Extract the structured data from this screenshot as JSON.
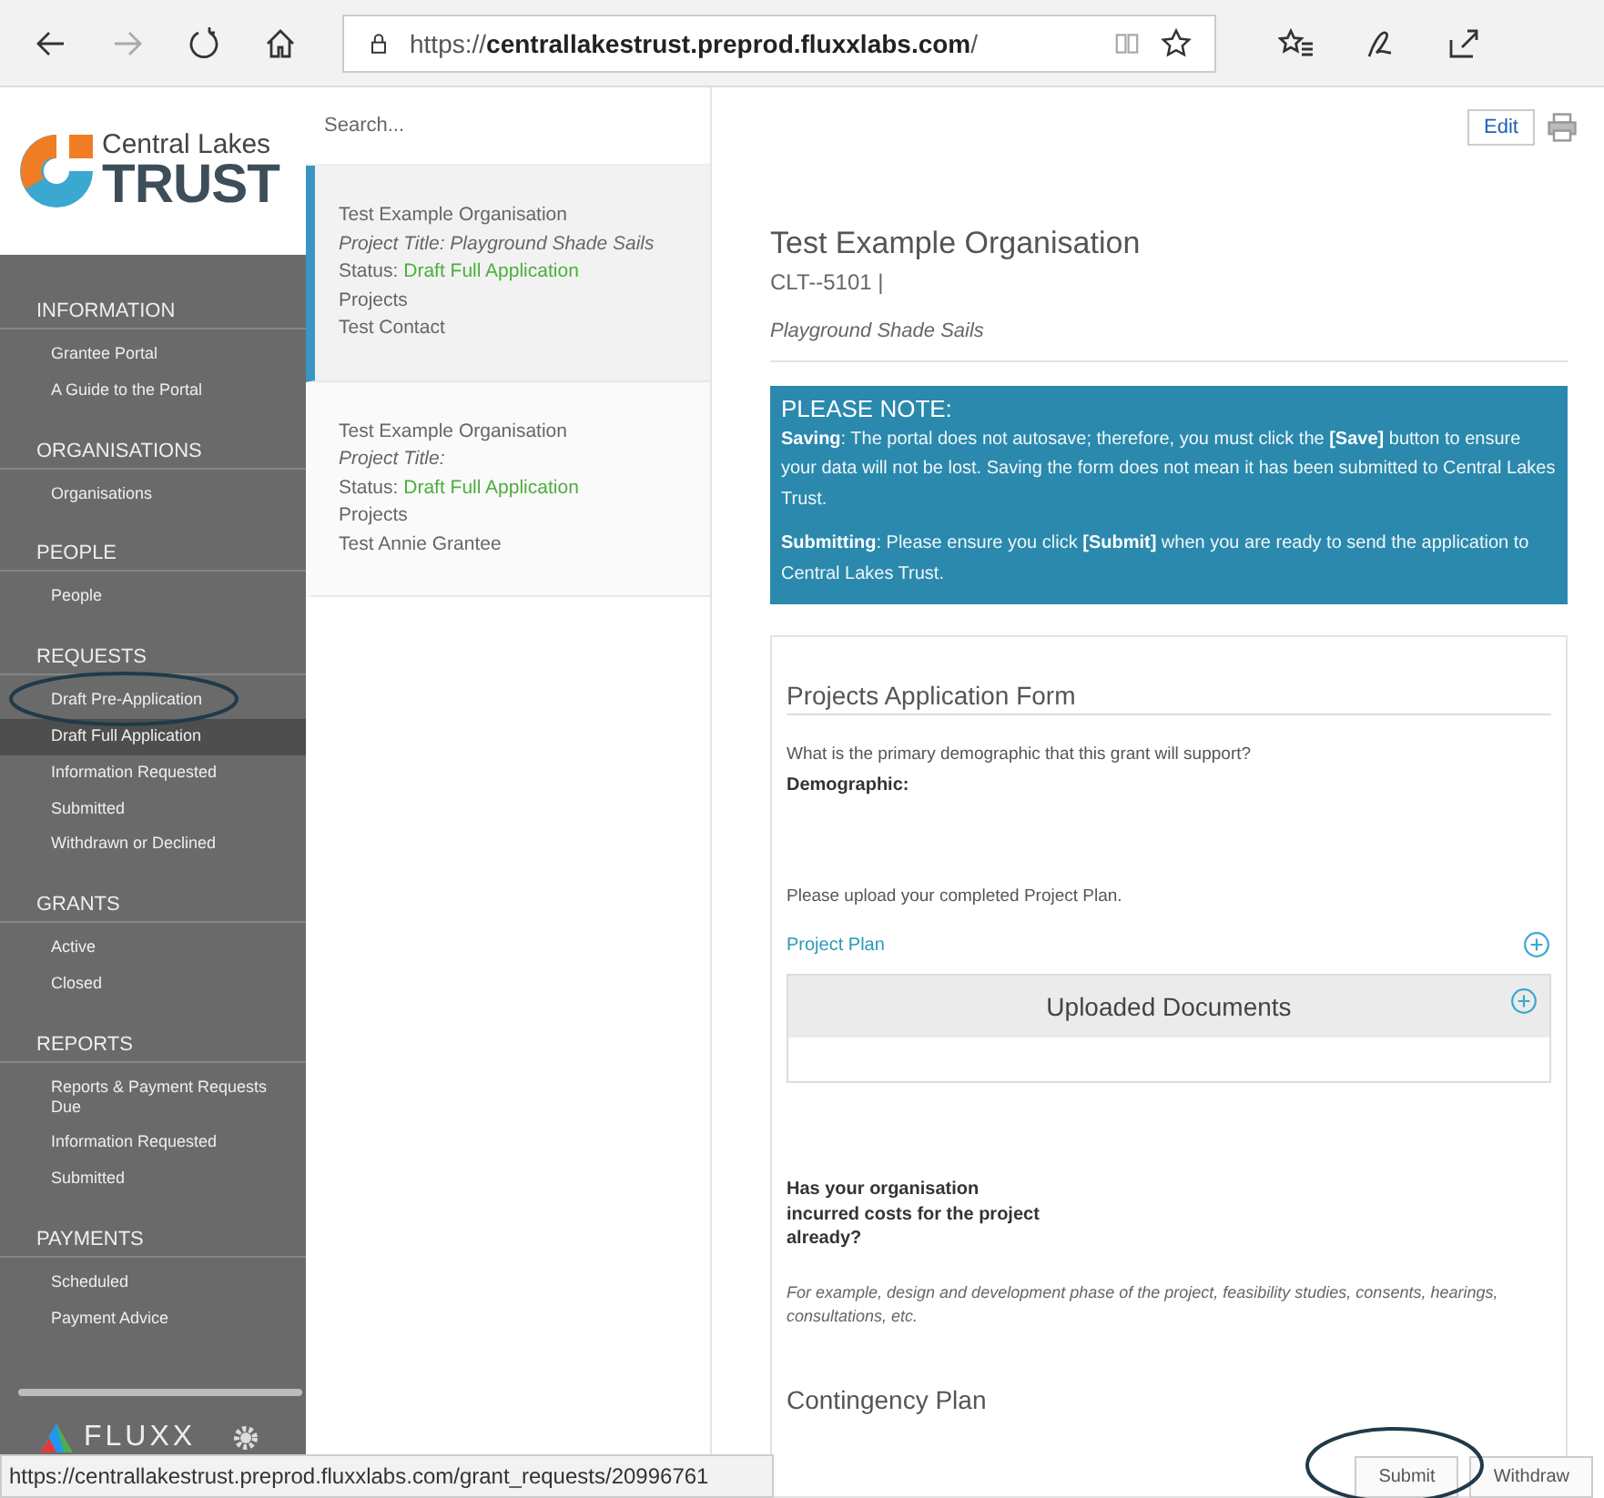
{
  "browser": {
    "url": "https://**centrallakestrust.preprod.fluxxlabs.com**/"
  },
  "logo": {
    "line1": "Central Lakes",
    "line2": "TRUST"
  },
  "sidebar": {
    "sections": [
      {
        "title": "INFORMATION",
        "items": [
          {
            "label": "Grantee Portal",
            "selected": false
          },
          {
            "label": "A Guide to the Portal",
            "selected": false
          }
        ]
      },
      {
        "title": "ORGANISATIONS",
        "items": [
          {
            "label": "Organisations",
            "selected": false
          }
        ]
      },
      {
        "title": "PEOPLE",
        "items": [
          {
            "label": "People",
            "selected": false
          }
        ]
      },
      {
        "title": "REQUESTS",
        "items": [
          {
            "label": "Draft Pre-Application",
            "selected": false
          },
          {
            "label": "Draft Full Application",
            "selected": true
          },
          {
            "label": "Information Requested",
            "selected": false
          },
          {
            "label": "Submitted",
            "selected": false
          },
          {
            "label": "Withdrawn or Declined",
            "selected": false
          }
        ]
      },
      {
        "title": "GRANTS",
        "items": [
          {
            "label": "Active",
            "selected": false
          },
          {
            "label": "Closed",
            "selected": false
          }
        ]
      },
      {
        "title": "REPORTS",
        "items": [
          {
            "label": "Reports & Payment Requests Due",
            "selected": false
          },
          {
            "label": "Information Requested",
            "selected": false
          },
          {
            "label": "Submitted",
            "selected": false
          }
        ]
      },
      {
        "title": "PAYMENTS",
        "items": [
          {
            "label": "Scheduled",
            "selected": false
          },
          {
            "label": "Payment Advice",
            "selected": false
          }
        ]
      }
    ],
    "footer_logo": "FLUXX"
  },
  "list": {
    "search": {
      "placeholder": "Search..."
    },
    "cards": [
      {
        "organisation": "Test Example Organisation",
        "project_title": "Project Title: Playground Shade Sails",
        "status_label": "Status:",
        "status": "Draft Full Application",
        "type": "Projects",
        "contact": "Test Contact",
        "selected": true
      },
      {
        "organisation": "Test Example Organisation",
        "project_title": "Project Title:",
        "status_label": "Status:",
        "status": "Draft Full Application",
        "type": "Projects",
        "contact": "Test Annie Grantee",
        "selected": false
      }
    ]
  },
  "main": {
    "edit_button": "Edit",
    "title": "Test Example Organisation",
    "code": "CLT--5101 |",
    "subtitle": "Playground Shade Sails",
    "note": {
      "heading": "PLEASE NOTE:",
      "paragraphs": [
        "**Saving**: The portal does not autosave; therefore, you must click the **[Save]** button to ensure your data will not be lost. Saving the form does not mean it has been submitted to Central Lakes Trust.",
        "**Submitting**: Please ensure you click **[Submit]** when you are ready to send the application to Central Lakes Trust."
      ]
    },
    "form": {
      "heading": "Projects Application Form",
      "question": "What is the primary demographic that this grant will support?",
      "field_label": "Demographic:",
      "upload_prompt": "Please upload your completed Project Plan.",
      "upload_link": "Project Plan",
      "documents_title": "Uploaded Documents",
      "costs_question": "Has your organisation incurred costs for the project already?",
      "costs_hint": "For example, design and development phase of the project, feasibility studies, consents, hearings, consultations, etc.",
      "next_section": "Contingency Plan"
    }
  },
  "status_bar": {
    "url": "https://centrallakestrust.preprod.fluxxlabs.com/grant_requests/20996761"
  },
  "actions": [
    "Submit",
    "Withdraw"
  ]
}
